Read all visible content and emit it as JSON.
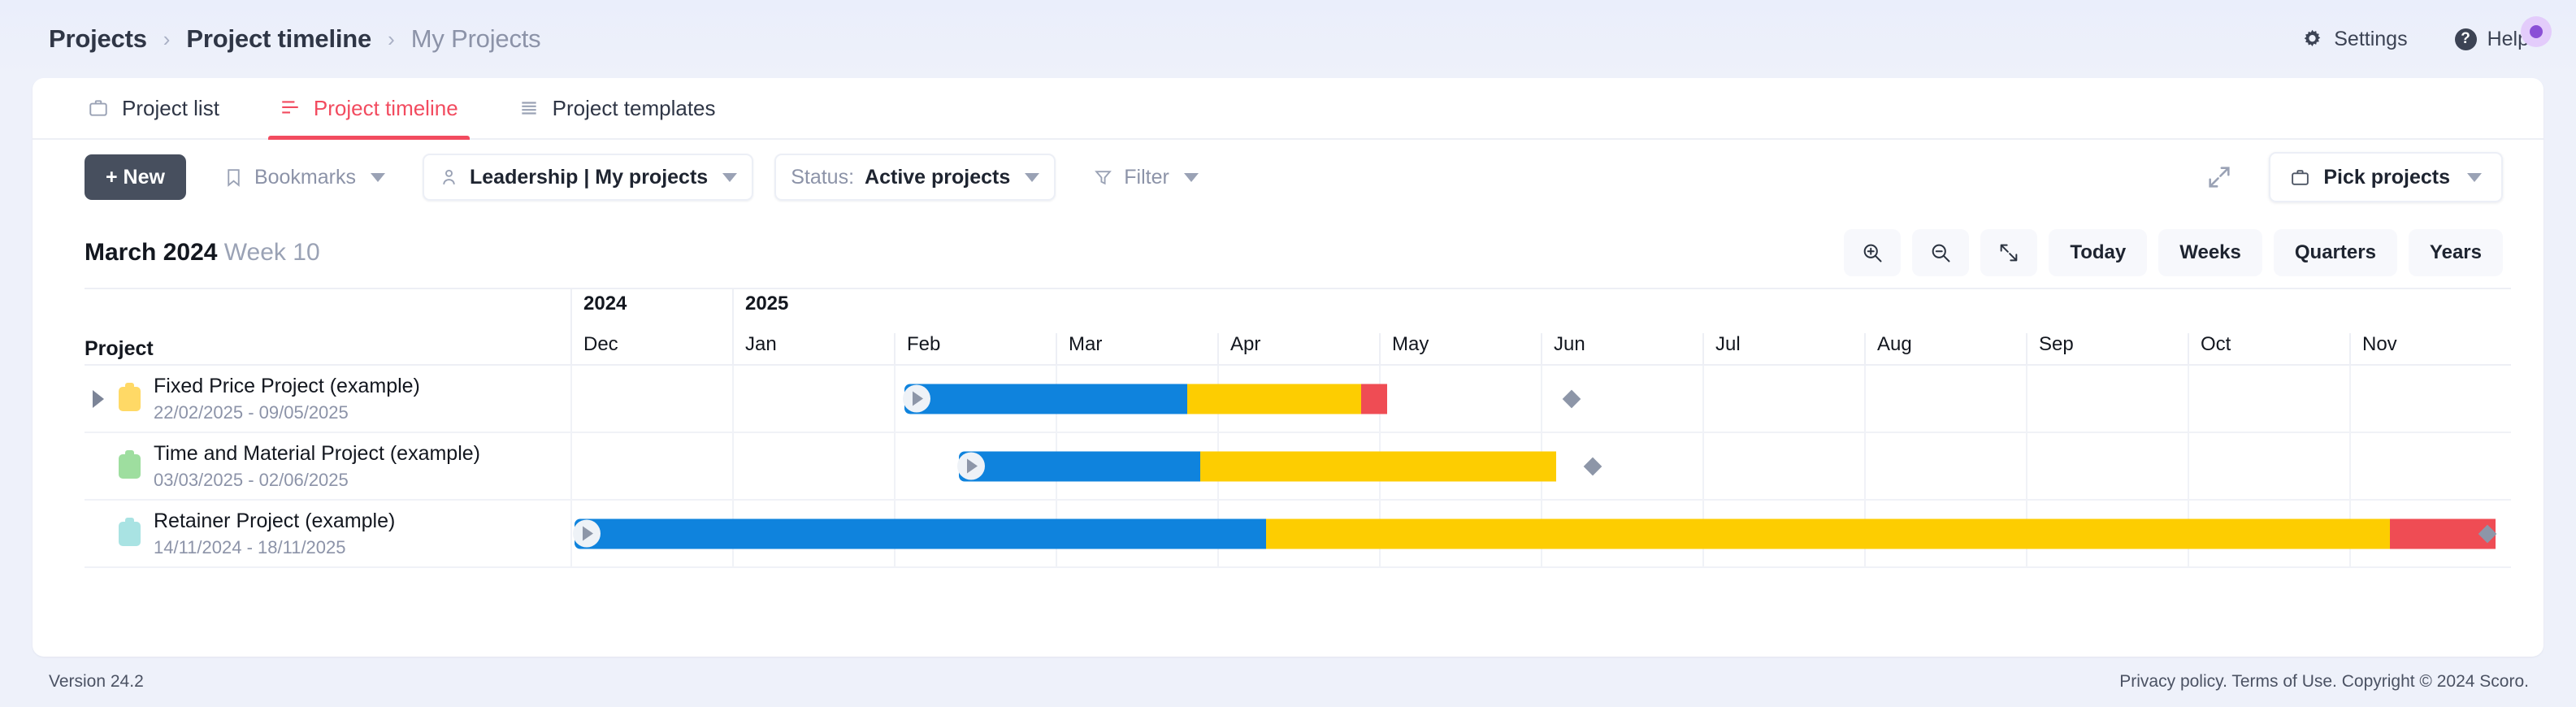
{
  "breadcrumb": {
    "items": [
      "Projects",
      "Project timeline",
      "My Projects"
    ],
    "separator": "›"
  },
  "header": {
    "settings_label": "Settings",
    "help_label": "Help",
    "gear_icon": "gear-icon",
    "help_icon": "question-circle-icon",
    "notification_icon": "notification-dot"
  },
  "tabs": [
    {
      "label": "Project list",
      "icon": "briefcase-icon",
      "active": false
    },
    {
      "label": "Project timeline",
      "icon": "timeline-icon",
      "active": true
    },
    {
      "label": "Project templates",
      "icon": "list-icon",
      "active": false
    }
  ],
  "toolbar": {
    "new_label": "+ New",
    "bookmarks_label": "Bookmarks",
    "view_label": "Leadership | My projects",
    "status_prefix": "Status:",
    "status_value": "Active projects",
    "filter_label": "Filter",
    "expand_icon": "expand-diagonal-icon",
    "pick_projects_label": "Pick projects"
  },
  "gantt": {
    "title_bold": "March 2024",
    "title_rest": "Week 10",
    "controls": [
      {
        "label": "",
        "icon": "zoom-in-icon",
        "name": "zoom-in-button"
      },
      {
        "label": "",
        "icon": "zoom-out-icon",
        "name": "zoom-out-button"
      },
      {
        "label": "",
        "icon": "fit-diagonal-icon",
        "name": "fit-to-screen-button"
      },
      {
        "label": "Today",
        "icon": "",
        "name": "today-button"
      },
      {
        "label": "Weeks",
        "icon": "",
        "name": "weeks-button"
      },
      {
        "label": "Quarters",
        "icon": "",
        "name": "quarters-button"
      },
      {
        "label": "Years",
        "icon": "",
        "name": "years-button"
      }
    ],
    "project_column_header": "Project",
    "years": [
      {
        "label": "2024",
        "span": 1
      },
      {
        "label": "2025",
        "span": 11
      }
    ],
    "months": [
      "Dec",
      "Jan",
      "Feb",
      "Mar",
      "Apr",
      "May",
      "Jun",
      "Jul",
      "Aug",
      "Sep",
      "Oct",
      "Nov"
    ],
    "rows": [
      {
        "name": "Fixed Price Project (example)",
        "dates": "22/02/2025 - 09/05/2025",
        "swatch_color": "#ffd966",
        "expandable": true,
        "bar": {
          "left_pct": 17.2,
          "width_pct": 24.9,
          "segments": [
            {
              "color": "#0f83dd",
              "width_pct": 58.5
            },
            {
              "color": "#fdcd01",
              "width_pct": 36.0
            },
            {
              "color": "#ef4c54",
              "width_pct": 5.5
            }
          ]
        },
        "milestone_pct": 51.6
      },
      {
        "name": "Time and Material Project (example)",
        "dates": "03/03/2025 - 02/06/2025",
        "swatch_color": "#9ede9f",
        "expandable": false,
        "bar": {
          "left_pct": 20.0,
          "width_pct": 30.8,
          "segments": [
            {
              "color": "#0f83dd",
              "width_pct": 40.5
            },
            {
              "color": "#fdcd01",
              "width_pct": 59.5
            }
          ]
        },
        "milestone_pct": 52.7
      },
      {
        "name": "Retainer Project (example)",
        "dates": "14/11/2024 - 18/11/2025",
        "swatch_color": "#a9e3e3",
        "expandable": false,
        "bar": {
          "left_pct": 0.2,
          "width_pct": 99.0,
          "segments": [
            {
              "color": "#0f83dd",
              "width_pct": 36.0
            },
            {
              "color": "#fdcd01",
              "width_pct": 58.5
            },
            {
              "color": "#ef4c54",
              "width_pct": 5.5
            }
          ]
        },
        "milestone_pct": 98.8
      }
    ]
  },
  "footer": {
    "version": "Version 24.2",
    "legal": "Privacy policy. Terms of Use. Copyright © 2024 Scoro."
  },
  "colors": {
    "accent_red": "#f24b5f",
    "bar_blue": "#0f83dd",
    "bar_yellow": "#fdcd01",
    "bar_red": "#ef4c54",
    "dark_button": "#474f5e",
    "page_bg": "#eef1fa"
  }
}
